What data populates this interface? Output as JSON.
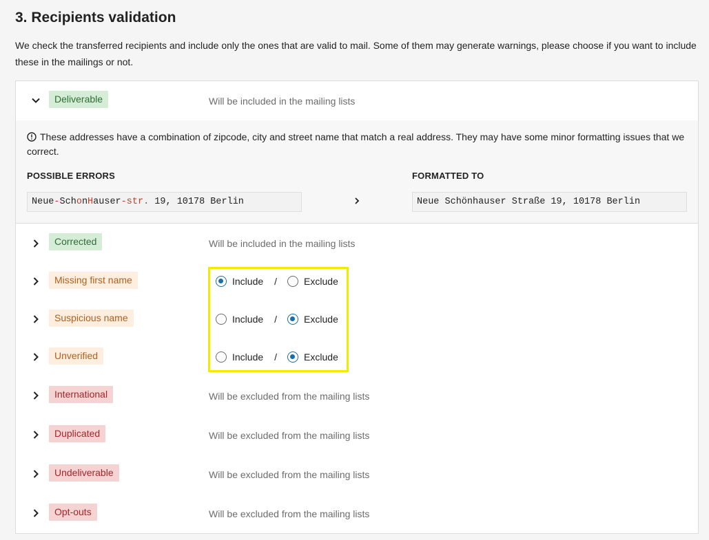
{
  "section": {
    "title": "3. Recipients validation",
    "description": "We check the transferred recipients and include only the ones that are valid to mail. Some of them may generate warnings, please choose if you want to include these in the mailings or not."
  },
  "deliverable": {
    "label": "Deliverable",
    "status": "Will be included in the mailing lists",
    "info": "These addresses have a combination of zipcode, city and street name that match a real address. They may have some minor formatting issues that we correct.",
    "possible_errors_heading": "POSSIBLE ERRORS",
    "formatted_to_heading": "FORMATTED TO",
    "error_example": {
      "p1": "Neue",
      "p2": "-",
      "p3": "Sch",
      "p4": "o",
      "p5": "n",
      "p6": "H",
      "p7": "auser",
      "p8": "-str.",
      "p9": " 19, 10178 Berlin"
    },
    "formatted_example": "Neue Schönhauser Straße 19, 10178 Berlin"
  },
  "corrected": {
    "label": "Corrected",
    "status": "Will be included in the mailing lists"
  },
  "choice_rows": [
    {
      "label": "Missing first name",
      "include": "Include",
      "separator": "/",
      "exclude": "Exclude",
      "selected": "include"
    },
    {
      "label": "Suspicious name",
      "include": "Include",
      "separator": "/",
      "exclude": "Exclude",
      "selected": "exclude"
    },
    {
      "label": "Unverified",
      "include": "Include",
      "separator": "/",
      "exclude": "Exclude",
      "selected": "exclude"
    }
  ],
  "excluded_rows": [
    {
      "label": "International",
      "status": "Will be excluded from the mailing lists"
    },
    {
      "label": "Duplicated",
      "status": "Will be excluded from the mailing lists"
    },
    {
      "label": "Undeliverable",
      "status": "Will be excluded from the mailing lists"
    },
    {
      "label": "Opt-outs",
      "status": "Will be excluded from the mailing lists"
    }
  ],
  "colors": {
    "green_badge_bg": "#d5ecd6",
    "orange_badge_bg": "#fdeee0",
    "red_badge_bg": "#f6d3d3",
    "radio_selected": "#1b6fa8",
    "highlight": "#f2ea00"
  },
  "icons": {
    "expanded": "chevron-down-icon",
    "collapsed": "chevron-right-icon",
    "info": "info-circle-icon",
    "arrow": "arrow-right-icon"
  }
}
